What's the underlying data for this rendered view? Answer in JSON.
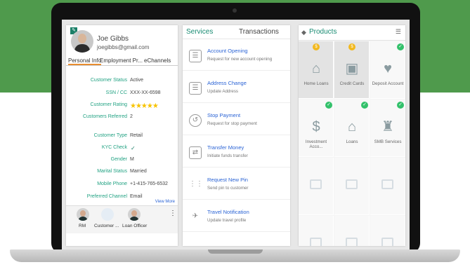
{
  "customer": {
    "name": "Joe Gibbs",
    "email": "joegibbs@gmail.com",
    "tabs": [
      "Personal Info",
      "Employment Pr...",
      "eChannels"
    ],
    "fields": [
      {
        "label": "Customer Status",
        "value": "Active"
      },
      {
        "label": "SSN / CC",
        "value": "XXX-XX-6598"
      },
      {
        "label": "Customer Rating",
        "value": "★★★★★"
      },
      {
        "label": "Customers Referred",
        "value": "2"
      },
      {
        "label": "Customer Type",
        "value": "Retail"
      },
      {
        "label": "KYC Check",
        "value": "✓"
      },
      {
        "label": "Gender",
        "value": "M"
      },
      {
        "label": "Marital Status",
        "value": "Married"
      },
      {
        "label": "Mobile Phone",
        "value": "+1-415-765-6532"
      },
      {
        "label": "Preferred Channel",
        "value": "Email"
      }
    ],
    "view_more": "View More",
    "relations": [
      "RM",
      "Customer ...",
      "Loan Officer"
    ]
  },
  "services": {
    "tabs": [
      "Services",
      "Transactions"
    ],
    "items": [
      {
        "title": "Account Opening",
        "desc": "Request for new account opening",
        "icon": "document-icon"
      },
      {
        "title": "Address Change",
        "desc": "Update Address",
        "icon": "address-icon"
      },
      {
        "title": "Stop Payment",
        "desc": "Request for stop payment",
        "icon": "stop-payment-icon"
      },
      {
        "title": "Transfer Money",
        "desc": "Initiate funds transfer",
        "icon": "transfer-icon"
      },
      {
        "title": "Request New Pin",
        "desc": "Send pin to customer",
        "icon": "pin-icon"
      },
      {
        "title": "Travel Notification",
        "desc": "Update travel profile",
        "icon": "travel-icon"
      }
    ]
  },
  "products": {
    "title": "Products",
    "items": [
      {
        "label": "Home Loans",
        "badge": "$",
        "badge_color": "#f2b81d",
        "icon": "home-icon"
      },
      {
        "label": "Credit Cards",
        "badge": "$",
        "badge_color": "#f2b81d",
        "icon": "image-icon"
      },
      {
        "label": "Deposit Account",
        "badge": "✓",
        "badge_color": "#33c16b",
        "icon": "piggy-bank-icon"
      },
      {
        "label": "Investment Acco...",
        "badge": "✓",
        "badge_color": "#33c16b",
        "icon": "money-bag-icon"
      },
      {
        "label": "Loans",
        "badge": "✓",
        "badge_color": "#33c16b",
        "icon": "home-icon"
      },
      {
        "label": "SMB Services",
        "badge": "✓",
        "badge_color": "#33c16b",
        "icon": "building-icon"
      }
    ],
    "menu_icon": "list-icon"
  }
}
